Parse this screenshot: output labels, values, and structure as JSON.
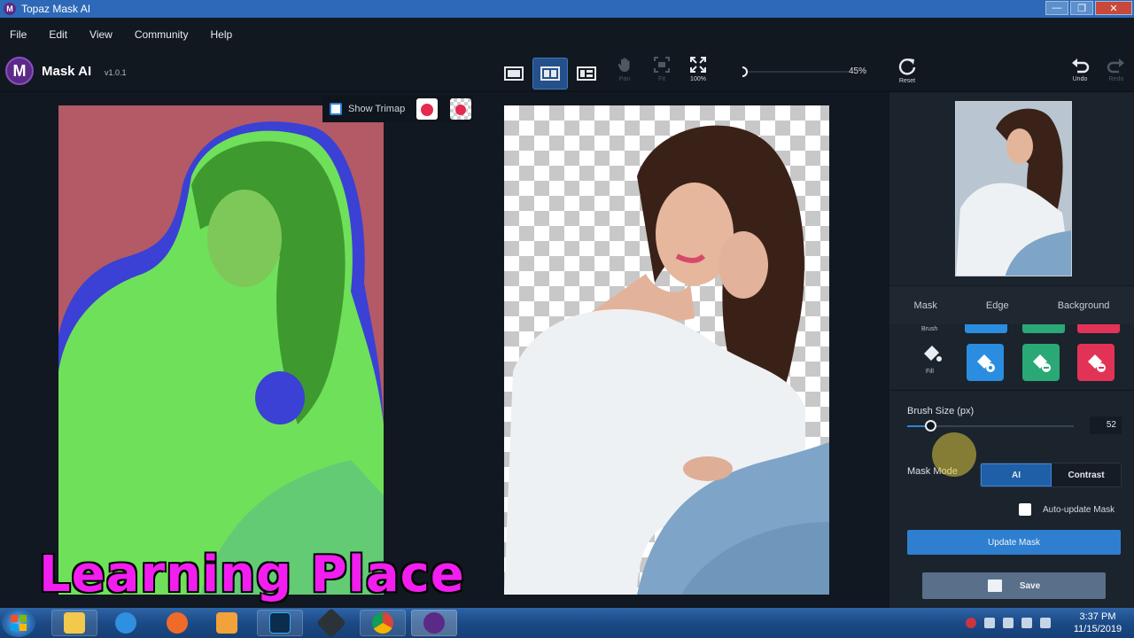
{
  "window": {
    "title": "Topaz Mask AI",
    "app_icon": "M",
    "controls": [
      "minimize",
      "maximize",
      "close"
    ]
  },
  "menu": [
    "File",
    "Edit",
    "View",
    "Community",
    "Help"
  ],
  "app": {
    "logo_letter": "M",
    "name": "Mask AI",
    "version": "v1.0.1"
  },
  "toolbar": {
    "views": [
      "single-view",
      "side-by-side",
      "split-view"
    ],
    "active_view": "side-by-side",
    "pan_label": "Pan",
    "fit_label": "Fit",
    "zoom100_label": "100%",
    "zoom_value": "45%",
    "reset_label": "Reset",
    "undo_label": "Undo",
    "redo_label": "Redo"
  },
  "trimap": {
    "label": "Show Trimap"
  },
  "watermark": "Learning Place",
  "panel": {
    "tabs": [
      "Mask",
      "Edge",
      "Background"
    ],
    "brush_label": "Brush",
    "fill_label": "Fill",
    "brush_colors": {
      "blue": "#2a8de0",
      "green": "#2aa876",
      "red": "#e23356"
    },
    "brush_size_label": "Brush Size (px)",
    "brush_size_value": "52",
    "mask_mode_label": "Mask Mode",
    "mask_mode_options": [
      "AI",
      "Contrast"
    ],
    "mask_mode_selected": "AI",
    "auto_update_label": "Auto-update Mask",
    "update_label": "Update Mask",
    "save_label": "Save"
  },
  "taskbar": {
    "apps": [
      "explorer",
      "internet-explorer",
      "firefox",
      "media-player",
      "photoshop",
      "nox",
      "chrome",
      "mask-ai"
    ],
    "time": "3:37 PM",
    "date": "11/15/2019"
  }
}
